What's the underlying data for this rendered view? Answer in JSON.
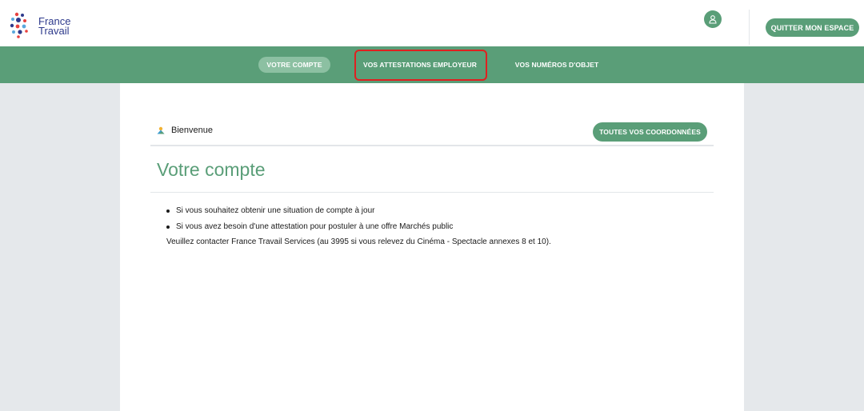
{
  "header": {
    "logo_line1": "France",
    "logo_line2": "Travail",
    "quit_label": "QUITTER MON ESPACE",
    "user_icon": "user-icon"
  },
  "nav": {
    "items": [
      {
        "label": "VOTRE COMPTE",
        "active": true
      },
      {
        "label": "VOS ATTESTATIONS EMPLOYEUR",
        "active": false
      },
      {
        "label": "VOS NUMÉROS D'OBJET",
        "active": false
      }
    ]
  },
  "main": {
    "welcome": "Bienvenue",
    "coord_button": "TOUTES VOS COORDONNÉES",
    "title": "Votre compte",
    "bullets": [
      "Si vous souhaitez obtenir une situation de compte à jour",
      "Si vous avez besoin d'une attestation pour postuler à une offre Marchés public"
    ],
    "contact": "Veuillez contacter France Travail Services (au 3995 si vous relevez du Cinéma - Spectacle annexes 8 et 10)."
  },
  "colors": {
    "brand_green": "#5a9e78",
    "active_pill": "#8cc0a2",
    "highlight_red": "#e02020",
    "logo_blue": "#2e3a8c"
  }
}
